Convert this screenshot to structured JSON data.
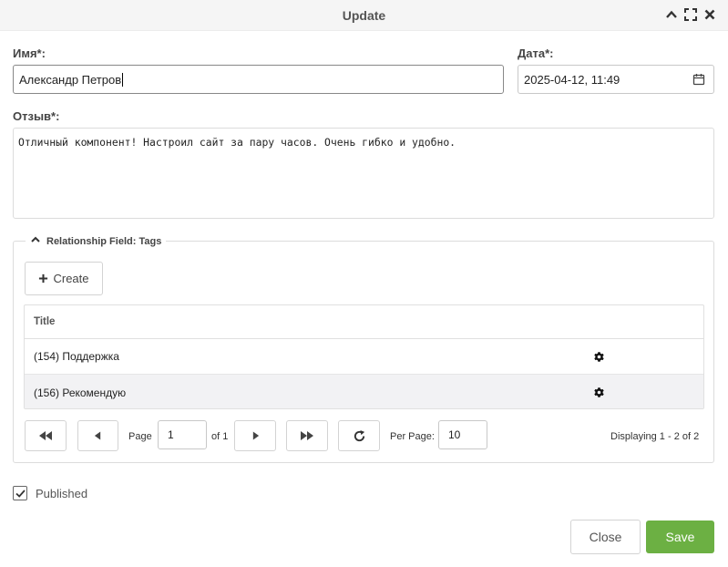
{
  "window": {
    "title": "Update"
  },
  "form": {
    "name_label": "Имя*:",
    "name_value": "Александр Петров",
    "date_label": "Дата*:",
    "date_value": "2025-04-12, 11:49",
    "review_label": "Отзыв*:",
    "review_value": "Отличный компонент! Настроил сайт за пару часов. Очень гибко и удобно."
  },
  "relationship": {
    "legend": "Relationship Field: Tags",
    "create_label": "Create",
    "column_title": "Title",
    "rows": [
      {
        "title": "(154) Поддержка"
      },
      {
        "title": "(156) Рекомендую"
      }
    ]
  },
  "pager": {
    "page_label": "Page",
    "page_value": "1",
    "of_label": "of 1",
    "per_page_label": "Per Page:",
    "per_page_value": "10",
    "displaying": "Displaying 1 - 2 of 2"
  },
  "published": {
    "label": "Published",
    "checked": true
  },
  "footer": {
    "close_label": "Close",
    "save_label": "Save"
  },
  "colors": {
    "save_button": "#6cb043",
    "titlebar": "#f5f5f5"
  }
}
